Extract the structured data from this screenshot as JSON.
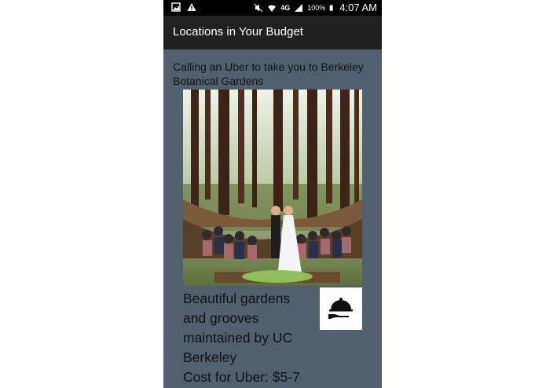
{
  "status_bar": {
    "battery": "100%",
    "time": "4:07 AM",
    "network": "4G"
  },
  "app_bar": {
    "title": "Locations in Your Budget"
  },
  "content": {
    "heading": "Calling an Uber to take you to Berkeley Botanical Gardens",
    "image": {
      "icon_name": "forest-wedding-photo"
    },
    "description": "Beautiful gardens and grooves maintained by UC Berkeley",
    "cost": "Cost for Uber: $5-7",
    "action_icon": "serving-cloche-icon"
  },
  "colors": {
    "background": "#52606e",
    "app_bar": "#212121",
    "status_bar": "#000000"
  }
}
